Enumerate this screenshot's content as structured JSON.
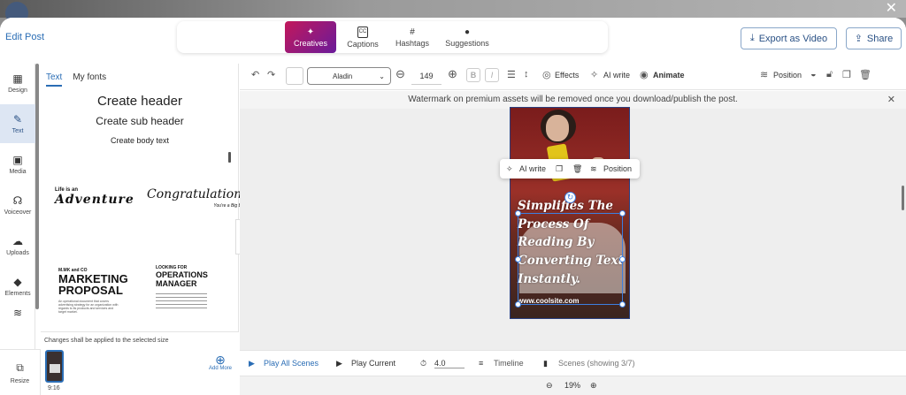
{
  "header": {
    "edit_post": "Edit Post",
    "close": "✕",
    "tabs": [
      {
        "label": "Creatives",
        "icon": "magic-wand-icon"
      },
      {
        "label": "Captions",
        "icon": "cc-icon"
      },
      {
        "label": "Hashtags",
        "icon": "hash-icon"
      },
      {
        "label": "Suggestions",
        "icon": "lightbulb-icon"
      }
    ],
    "export_label": "Export as Video",
    "share_label": "Share"
  },
  "sidebar": {
    "items": [
      {
        "label": "Design"
      },
      {
        "label": "Text"
      },
      {
        "label": "Media"
      },
      {
        "label": "Voiceover"
      },
      {
        "label": "Uploads"
      },
      {
        "label": "Elements"
      }
    ],
    "resize_label": "Resize"
  },
  "panel": {
    "tab_text": "Text",
    "tab_fonts": "My fonts",
    "create_header": "Create header",
    "create_subheader": "Create sub header",
    "create_body": "Create body text",
    "templates": {
      "adventure_small": "Life is an",
      "adventure_big": "Adventure",
      "congrats": "Congratulations!",
      "congrats_sub": "You're a Big Brother",
      "marketing_small": "M.MK and CO",
      "marketing_big": "MARKETING PROPOSAL",
      "marketing_body": "An operational document that covers advertising strategy for an organization with regards to its products and services and target market.",
      "operations_small": "LOOKING FOR",
      "operations_big": "OPERATIONS MANAGER"
    },
    "changes_msg": "Changes shall be applied to the selected size",
    "ratio": "9:16",
    "add_more": "Add More"
  },
  "toolbar": {
    "font": "Aladin",
    "size": "149",
    "bold": "B",
    "italic": "I",
    "effects": "Effects",
    "ai_write": "AI write",
    "animate": "Animate",
    "position": "Position"
  },
  "banner": {
    "text": "Watermark on premium assets will be removed once you download/publish the post."
  },
  "canvas": {
    "headline": "Simplifies The Process Of Reading By Converting Text Instantly.",
    "site": "www.coolsite.com",
    "popover_ai": "AI write",
    "popover_position": "Position"
  },
  "bottombar": {
    "play_all": "Play All Scenes",
    "play_current": "Play Current",
    "duration": "4.0",
    "timeline": "Timeline",
    "scenes": "Scenes (showing 3/7)"
  },
  "zoom": {
    "level": "19%"
  },
  "colors": {
    "accent": "#2a6db5",
    "active_tab_start": "#c2185b",
    "active_tab_end": "#6a1b9a",
    "selection": "#3d7fe0"
  }
}
